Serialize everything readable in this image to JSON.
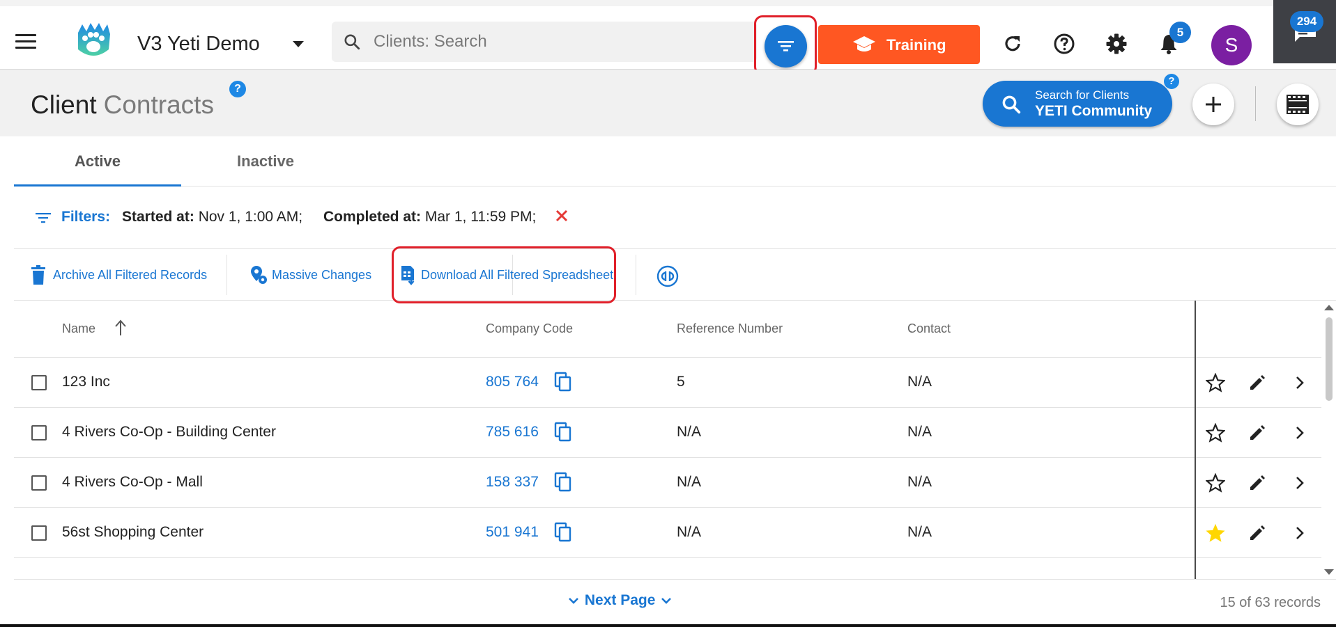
{
  "app": {
    "org_name": "V3 Yeti Demo",
    "search_placeholder": "Clients: Search",
    "training_label": "Training",
    "notification_count": "5",
    "avatar_initial": "S",
    "chat_count": "294"
  },
  "page": {
    "title_main": "Client",
    "title_sub": "Contracts",
    "help_label": "?",
    "community": {
      "line1": "Search for Clients",
      "line2": "YETI Community"
    }
  },
  "tabs": [
    {
      "label": "Active",
      "active": true
    },
    {
      "label": "Inactive",
      "active": false
    }
  ],
  "filters": {
    "label": "Filters:",
    "started_label": "Started at:",
    "started_value": "Nov 1, 1:00 AM;",
    "completed_label": "Completed at:",
    "completed_value": "Mar 1, 11:59 PM;"
  },
  "actions": {
    "archive": "Archive All Filtered Records",
    "massive": "Massive Changes",
    "download": "Download All Filtered Spreadsheet"
  },
  "table": {
    "columns": [
      "Name",
      "Company Code",
      "Reference Number",
      "Contact"
    ],
    "rows": [
      {
        "name": "123 Inc",
        "code": "805 764",
        "ref": "5",
        "contact": "N/A",
        "starred": false
      },
      {
        "name": "4 Rivers Co-Op - Building Center",
        "code": "785 616",
        "ref": "N/A",
        "contact": "N/A",
        "starred": false
      },
      {
        "name": "4 Rivers Co-Op - Mall",
        "code": "158 337",
        "ref": "N/A",
        "contact": "N/A",
        "starred": false
      },
      {
        "name": "56st Shopping Center",
        "code": "501 941",
        "ref": "N/A",
        "contact": "N/A",
        "starred": true
      }
    ]
  },
  "footer": {
    "next_page": "Next Page",
    "records": "15 of 63 records"
  },
  "colors": {
    "primary": "#1976d2",
    "training": "#ff5722",
    "avatar": "#7b1fa2",
    "highlight": "#e0202a",
    "star_filled": "#ffd600"
  }
}
